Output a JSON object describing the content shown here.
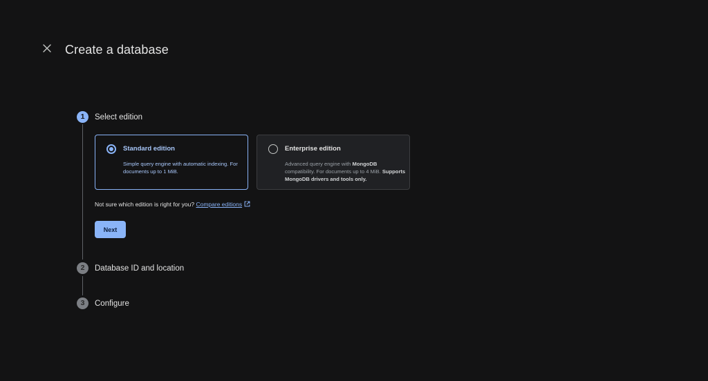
{
  "header": {
    "title": "Create a database"
  },
  "steps": [
    {
      "number": "1",
      "label": "Select edition",
      "state": "active"
    },
    {
      "number": "2",
      "label": "Database ID and location",
      "state": "inactive"
    },
    {
      "number": "3",
      "label": "Configure",
      "state": "inactive"
    }
  ],
  "editions": {
    "standard": {
      "title": "Standard edition",
      "description": "Simple query engine with automatic indexing. For documents up to 1 MiB.",
      "selected": true
    },
    "enterprise": {
      "title": "Enterprise edition",
      "desc_part1": "Advanced query engine with ",
      "desc_bold1": "MongoDB",
      "desc_part2": " compatibility. For documents up to 4 MiB. ",
      "desc_bold2": "Supports MongoDB drivers and tools only.",
      "selected": false
    }
  },
  "helper": {
    "text": "Not sure which edition is right for you?",
    "link_label": "Compare editions"
  },
  "actions": {
    "next_label": "Next"
  },
  "colors": {
    "background": "#131314",
    "accent": "#8ab4f8",
    "card_unselected_bg": "#202124"
  }
}
